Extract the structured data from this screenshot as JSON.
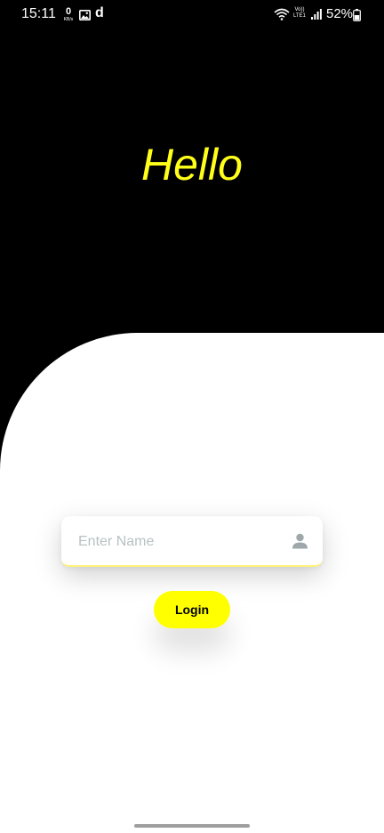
{
  "status_bar": {
    "time": "15:11",
    "net_speed_value": "0",
    "net_speed_unit": "KB/s",
    "app_badge": "d",
    "volte_top": "Vo))",
    "volte_bottom": "LTE1",
    "battery_percent": "52%"
  },
  "header": {
    "title": "Hello"
  },
  "form": {
    "name_placeholder": "Enter Name",
    "name_value": "",
    "login_label": "Login"
  },
  "colors": {
    "background": "#000000",
    "accent_yellow": "#ffff00",
    "title_yellow": "#ffff1a",
    "panel": "#ffffff"
  },
  "icons": {
    "field_icon": "person-icon",
    "status_icons": [
      "gallery-icon",
      "wifi-icon",
      "signal-icon",
      "battery-icon"
    ]
  }
}
